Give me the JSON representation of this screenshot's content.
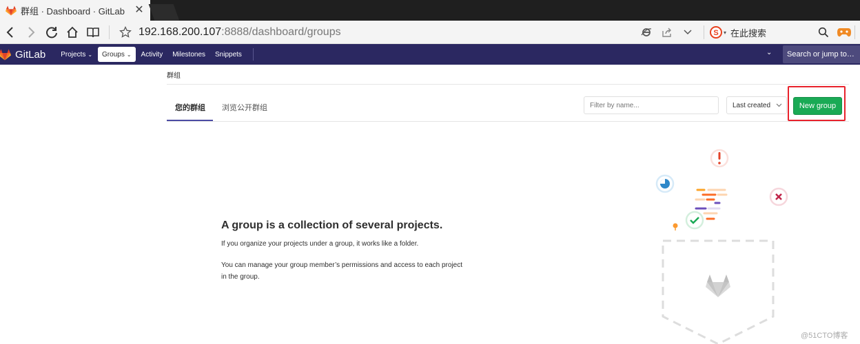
{
  "browser": {
    "tab_title": "群组 · Dashboard · GitLab",
    "tab_close": "✕",
    "url_host": "192.168.200.107",
    "url_rest": ":8888/dashboard/groups",
    "search_placeholder": "在此搜索"
  },
  "gitlab": {
    "brand": "GitLab",
    "nav": {
      "projects": "Projects",
      "groups": "Groups",
      "activity": "Activity",
      "milestones": "Milestones",
      "snippets": "Snippets"
    },
    "search_placeholder": "Search or jump to…"
  },
  "page": {
    "breadcrumb": "群组",
    "tabs": {
      "your_groups": "您的群组",
      "explore": "浏览公开群组"
    },
    "filter_placeholder": "Filter by name...",
    "sort_selected": "Last created",
    "new_group_label": "New group"
  },
  "empty_state": {
    "title": "A group is a collection of several projects.",
    "line1": "If you organize your projects under a group, it works like a folder.",
    "line2": "You can manage your group member’s permissions and access to each project in the group."
  },
  "watermark": "@51CTO博客",
  "colors": {
    "header_bg": "#2b2861",
    "new_group_green": "#1aaa55",
    "highlight_red": "#e8212b",
    "active_tab_underline": "#4b4ba3"
  }
}
